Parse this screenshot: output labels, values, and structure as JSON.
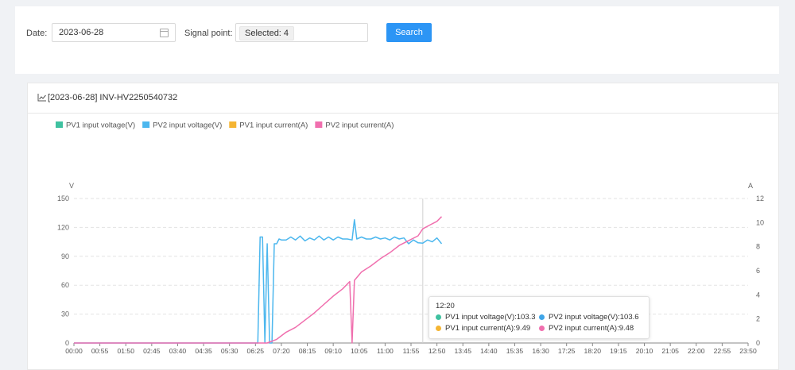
{
  "search": {
    "date_label": "Date",
    "date_value": "2023-06-28",
    "signal_label": "Signal point",
    "signal_value": "Selected: 4",
    "search_button": "Search"
  },
  "card": {
    "title": "[2023-06-28] INV-HV2250540732"
  },
  "tooltip": {
    "time": "12:20",
    "items": [
      {
        "text": "PV1 input voltage(V):103.3",
        "color": "#3fc1a0"
      },
      {
        "text": "PV2 input voltage(V):103.6",
        "color": "#3fa5e8"
      },
      {
        "text": "PV1 input current(A):9.49",
        "color": "#f5b533"
      },
      {
        "text": "PV2 input current(A):9.48",
        "color": "#f06fae"
      }
    ]
  },
  "chart_data": {
    "type": "line",
    "legend": [
      {
        "name": "PV1 input voltage(V)",
        "color": "#3fc1a0"
      },
      {
        "name": "PV2 input voltage(V)",
        "color": "#4cb7ee"
      },
      {
        "name": "PV1 input current(A)",
        "color": "#f5b533"
      },
      {
        "name": "PV2 input current(A)",
        "color": "#f06fae"
      }
    ],
    "legend_position": "top-left",
    "ylabel_left": "V",
    "ylabel_right": "A",
    "ylim_left": [
      0,
      150
    ],
    "yticks_left": [
      0,
      30,
      60,
      90,
      120,
      150
    ],
    "ylim_right": [
      0,
      12
    ],
    "yticks_right": [
      0,
      2,
      4,
      6,
      8,
      10,
      12
    ],
    "x_tick_labels": [
      "00:00",
      "00:55",
      "01:50",
      "02:45",
      "03:40",
      "04:35",
      "05:30",
      "06:25",
      "07:20",
      "08:15",
      "09:10",
      "10:05",
      "11:00",
      "11:55",
      "12:50",
      "13:45",
      "14:40",
      "15:35",
      "16:30",
      "17:25",
      "18:20",
      "19:15",
      "20:10",
      "21:05",
      "22:00",
      "22:55",
      "23:50"
    ],
    "crosshair_time": "12:20",
    "series": [
      {
        "name": "PV2 input voltage(V)",
        "axis": "left",
        "color": "#4cb7ee",
        "points": [
          [
            "00:00",
            0
          ],
          [
            "06:30",
            0
          ],
          [
            "06:35",
            110
          ],
          [
            "06:40",
            110
          ],
          [
            "06:45",
            0
          ],
          [
            "06:50",
            103
          ],
          [
            "06:55",
            0
          ],
          [
            "07:00",
            0
          ],
          [
            "07:05",
            103
          ],
          [
            "07:10",
            103
          ],
          [
            "07:15",
            108
          ],
          [
            "07:20",
            107
          ],
          [
            "07:30",
            107
          ],
          [
            "07:40",
            110
          ],
          [
            "07:50",
            107
          ],
          [
            "08:00",
            111
          ],
          [
            "08:10",
            106
          ],
          [
            "08:20",
            109
          ],
          [
            "08:30",
            107
          ],
          [
            "08:40",
            111
          ],
          [
            "08:50",
            107
          ],
          [
            "09:00",
            110
          ],
          [
            "09:10",
            107
          ],
          [
            "09:20",
            110
          ],
          [
            "09:30",
            108
          ],
          [
            "09:40",
            108
          ],
          [
            "09:50",
            107
          ],
          [
            "09:55",
            128
          ],
          [
            "10:00",
            108
          ],
          [
            "10:10",
            110
          ],
          [
            "10:20",
            108
          ],
          [
            "10:30",
            108
          ],
          [
            "10:40",
            110
          ],
          [
            "10:50",
            108
          ],
          [
            "11:00",
            109
          ],
          [
            "11:10",
            107
          ],
          [
            "11:20",
            110
          ],
          [
            "11:30",
            108
          ],
          [
            "11:40",
            109
          ],
          [
            "11:50",
            103
          ],
          [
            "12:00",
            107
          ],
          [
            "12:10",
            104
          ],
          [
            "12:20",
            103.6
          ],
          [
            "12:30",
            107
          ],
          [
            "12:40",
            105
          ],
          [
            "12:50",
            109
          ],
          [
            "13:00",
            103
          ]
        ]
      },
      {
        "name": "PV2 input current(A)",
        "axis": "right",
        "color": "#f06fae",
        "points": [
          [
            "00:00",
            0
          ],
          [
            "06:50",
            0
          ],
          [
            "07:10",
            0.3
          ],
          [
            "07:30",
            0.9
          ],
          [
            "07:50",
            1.3
          ],
          [
            "08:10",
            1.9
          ],
          [
            "08:30",
            2.5
          ],
          [
            "08:50",
            3.2
          ],
          [
            "09:10",
            3.9
          ],
          [
            "09:30",
            4.5
          ],
          [
            "09:45",
            5.1
          ],
          [
            "09:50",
            0
          ],
          [
            "09:55",
            5.2
          ],
          [
            "10:10",
            5.9
          ],
          [
            "10:30",
            6.4
          ],
          [
            "10:50",
            7.0
          ],
          [
            "11:10",
            7.5
          ],
          [
            "11:30",
            8.1
          ],
          [
            "11:50",
            8.5
          ],
          [
            "12:10",
            8.9
          ],
          [
            "12:20",
            9.48
          ],
          [
            "12:35",
            9.8
          ],
          [
            "12:50",
            10.1
          ],
          [
            "13:00",
            10.5
          ]
        ]
      }
    ]
  }
}
